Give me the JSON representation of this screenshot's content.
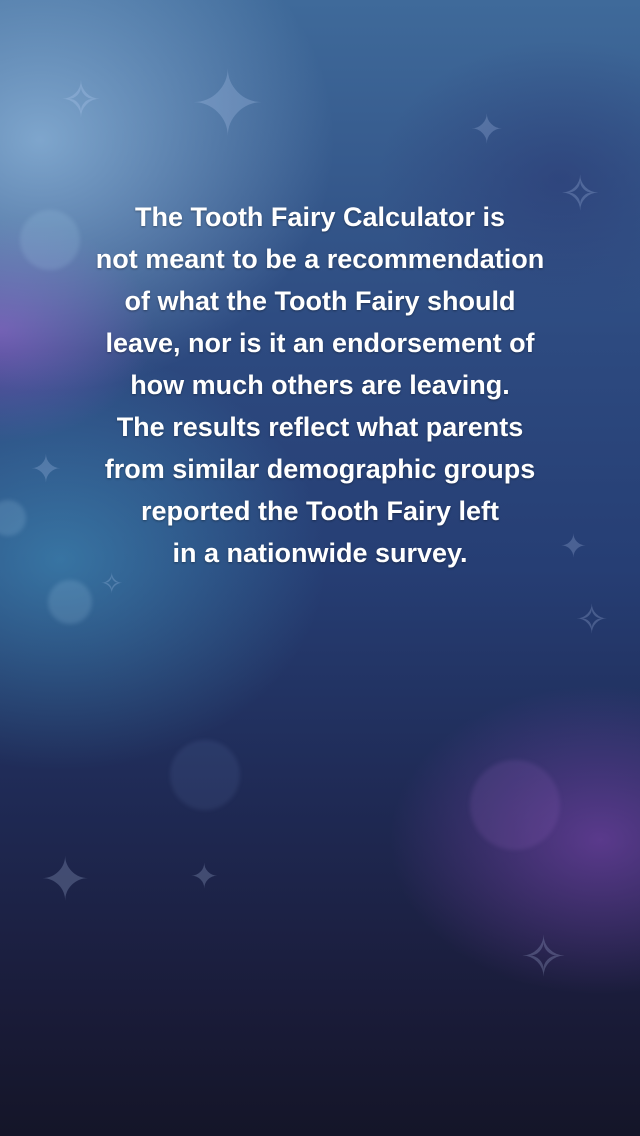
{
  "disclaimer": {
    "lines": [
      "The Tooth Fairy Calculator is",
      "not meant to be a recommendation",
      "of what the Tooth Fairy should",
      "leave, nor is it an endorsement of",
      "how much others are leaving.",
      "The results reflect what parents",
      "from similar demographic groups",
      "reported the Tooth Fairy left",
      "in a nationwide survey."
    ]
  },
  "background": {
    "top_color": "#3f6a9a",
    "bottom_color": "#141528",
    "accent_purple": "#8a4bc0",
    "accent_teal": "#46a0c8",
    "decoration": "sparkle-icon"
  }
}
